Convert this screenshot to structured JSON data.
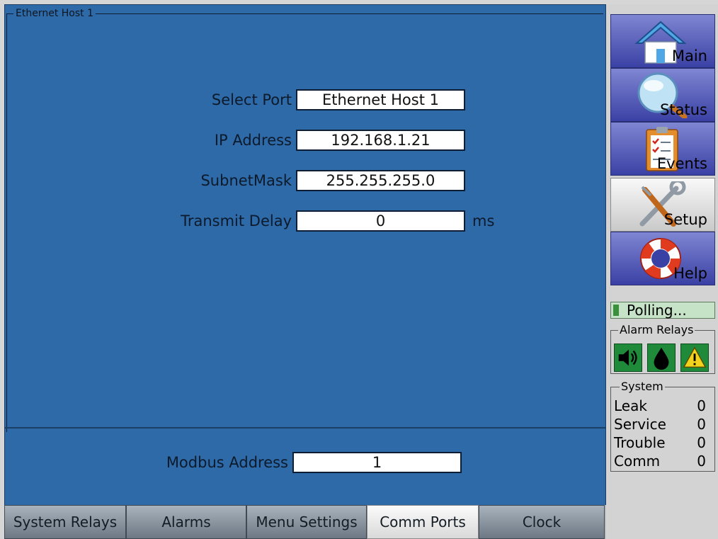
{
  "panel": {
    "group_title": "Ethernet Host 1"
  },
  "fields": {
    "select_port": {
      "label": "Select Port",
      "value": "Ethernet Host 1"
    },
    "ip_address": {
      "label": "IP Address",
      "value": "192.168.1.21"
    },
    "subnet_mask": {
      "label": "SubnetMask",
      "value": "255.255.255.0"
    },
    "transmit_delay": {
      "label": "Transmit Delay",
      "value": "0",
      "unit": "ms"
    },
    "modbus_address": {
      "label": "Modbus Address",
      "value": "1"
    }
  },
  "tabs": [
    {
      "label": "System Relays",
      "active": false
    },
    {
      "label": "Alarms",
      "active": false
    },
    {
      "label": "Menu Settings",
      "active": false
    },
    {
      "label": "Comm Ports",
      "active": true
    },
    {
      "label": "Clock",
      "active": false
    }
  ],
  "sidebar": {
    "nav": [
      {
        "label": "Main",
        "icon": "home-icon",
        "selected": false
      },
      {
        "label": "Status",
        "icon": "magnifier-icon",
        "selected": false
      },
      {
        "label": "Events",
        "icon": "clipboard-icon",
        "selected": false
      },
      {
        "label": "Setup",
        "icon": "tools-icon",
        "selected": true
      },
      {
        "label": "Help",
        "icon": "lifebuoy-icon",
        "selected": false
      }
    ],
    "polling_text": "Polling...",
    "alarm_relays": {
      "title": "Alarm Relays",
      "icons": [
        "speaker-icon",
        "drop-icon",
        "warning-icon"
      ]
    },
    "system": {
      "title": "System",
      "rows": [
        {
          "label": "Leak",
          "value": "0"
        },
        {
          "label": "Service",
          "value": "0"
        },
        {
          "label": "Trouble",
          "value": "0"
        },
        {
          "label": "Comm",
          "value": "0"
        }
      ]
    }
  },
  "colors": {
    "panel_blue": "#2e6aa8",
    "nav_blue": "#3a41a4",
    "relay_green": "#1f8a3a",
    "warning_yellow": "#f2d21b"
  }
}
